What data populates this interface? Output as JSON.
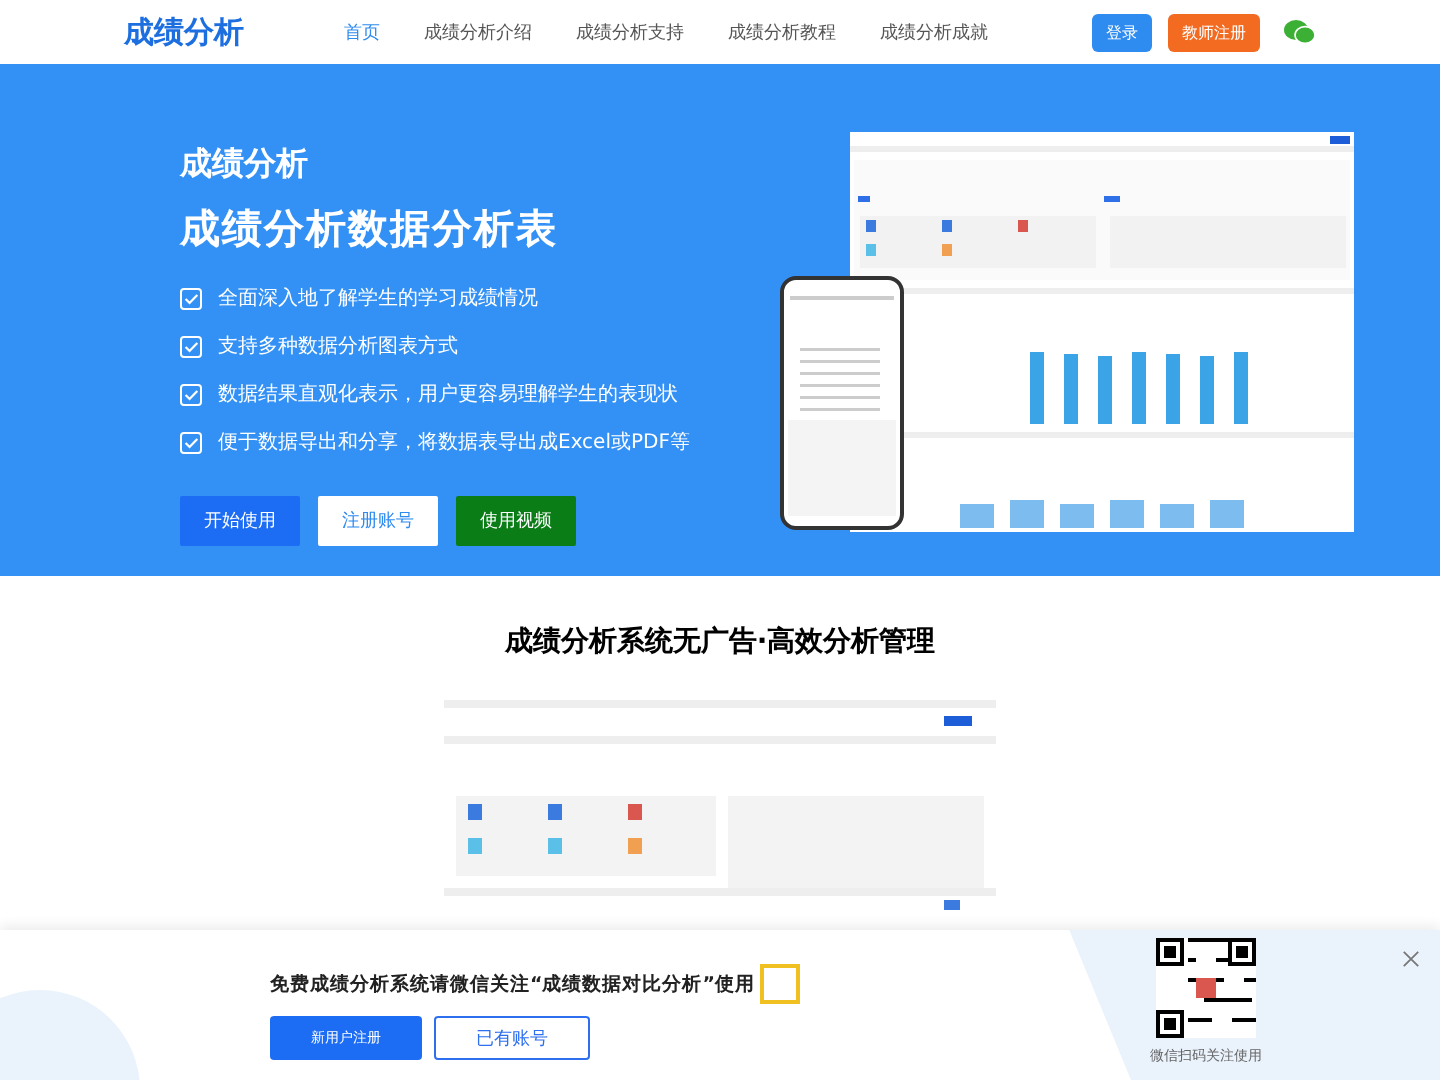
{
  "header": {
    "logo": "成绩分析",
    "nav": [
      {
        "label": "首页",
        "selected": true
      },
      {
        "label": "成绩分析介绍",
        "selected": false
      },
      {
        "label": "成绩分析支持",
        "selected": false
      },
      {
        "label": "成绩分析教程",
        "selected": false
      },
      {
        "label": "成绩分析成就",
        "selected": false
      }
    ],
    "login": "登录",
    "register": "教师注册"
  },
  "hero": {
    "subtitle": "成绩分析",
    "title": "成绩分析数据分析表",
    "features": [
      {
        "text": "全面深入地了解学生的学习成绩情况",
        "checked": true
      },
      {
        "text": "支持多种数据分析图表方式",
        "checked": true
      },
      {
        "text": "数据结果直观化表示，用户更容易理解学生的表现状",
        "checked": true
      },
      {
        "text": "便于数据导出和分享，将数据表导出成Excel或PDF等",
        "checked": true
      }
    ],
    "buttons": [
      {
        "label": "开始使用",
        "kind": "primary"
      },
      {
        "label": "注册账号",
        "kind": "outline"
      },
      {
        "label": "使用视频",
        "kind": "video"
      }
    ]
  },
  "showcase": {
    "title": "成绩分析系统无广告·高效分析管理"
  },
  "popup": {
    "message": "免费成绩分析系统请微信关注“成绩数据对比分析”使用",
    "new_user": "新用户注册",
    "have_account": "已有账号",
    "qr_caption": "微信扫码关注使用"
  }
}
